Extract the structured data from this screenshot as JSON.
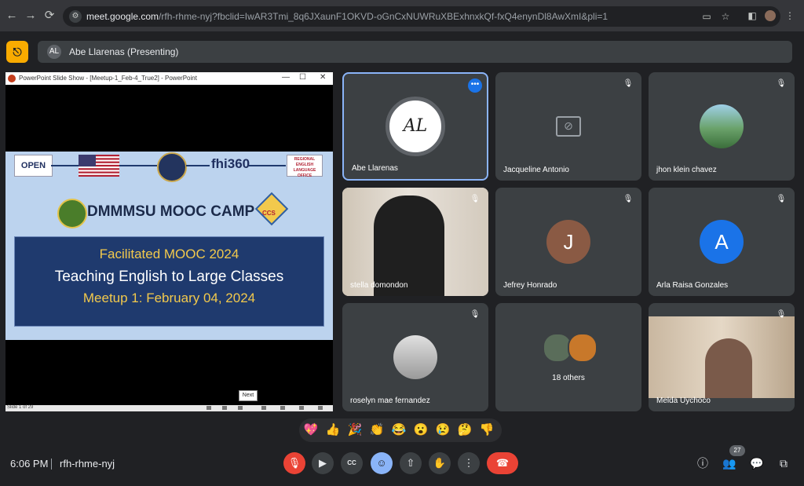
{
  "browser": {
    "url_host": "meet.google.com",
    "url_path": "/rfh-rhme-nyj?fbclid=IwAR3Tmi_8q6JXaunF1OKVD-oGnCxNUWRuXBExhnxkQf-fxQ4enynDl8AwXmI&pli=1"
  },
  "presenting_banner": {
    "label": "Abe Llarenas (Presenting)"
  },
  "slideshow": {
    "window_title": "PowerPoint Slide Show - [Meetup-1_Feb-4_True2] - PowerPoint",
    "slide_status": "Slide 1 of 29",
    "next_tooltip": "Next",
    "logos": {
      "open": "OPEN",
      "fhi": "fhi360",
      "relo": "REGIONAL ENGLISH LANGUAGE OFFICE",
      "ccs": "CCS"
    },
    "slide": {
      "camp_title": "DMMMSU MOOC CAMP",
      "line1": "Facilitated MOOC 2024",
      "line2": "Teaching English to Large Classes",
      "line3": "Meetup 1:  February 04, 2024"
    }
  },
  "participants": [
    {
      "name": "Abe Llarenas",
      "avatar": "AL"
    },
    {
      "name": "Jacqueline Antonio"
    },
    {
      "name": "jhon klein chavez"
    },
    {
      "name": "stella domondon"
    },
    {
      "name": "Jefrey Honrado",
      "initial": "J"
    },
    {
      "name": "Arla Raisa Gonzales",
      "initial": "A"
    },
    {
      "name": "roselyn mae fernandez"
    },
    {
      "name": "18 others"
    },
    {
      "name": "Melda Uychoco"
    }
  ],
  "reactions": [
    "💖",
    "👍",
    "🎉",
    "👏",
    "😂",
    "😮",
    "😢",
    "🤔",
    "👎"
  ],
  "footer": {
    "time": "6:06 PM",
    "meeting_code": "rfh-rhme-nyj",
    "participant_count": "27"
  },
  "colors": {
    "meet_bg": "#202124",
    "tile_bg": "#3c4043",
    "accent_blue": "#8ab4f8",
    "danger_red": "#ea4335",
    "exit_yellow": "#f9ab00"
  }
}
